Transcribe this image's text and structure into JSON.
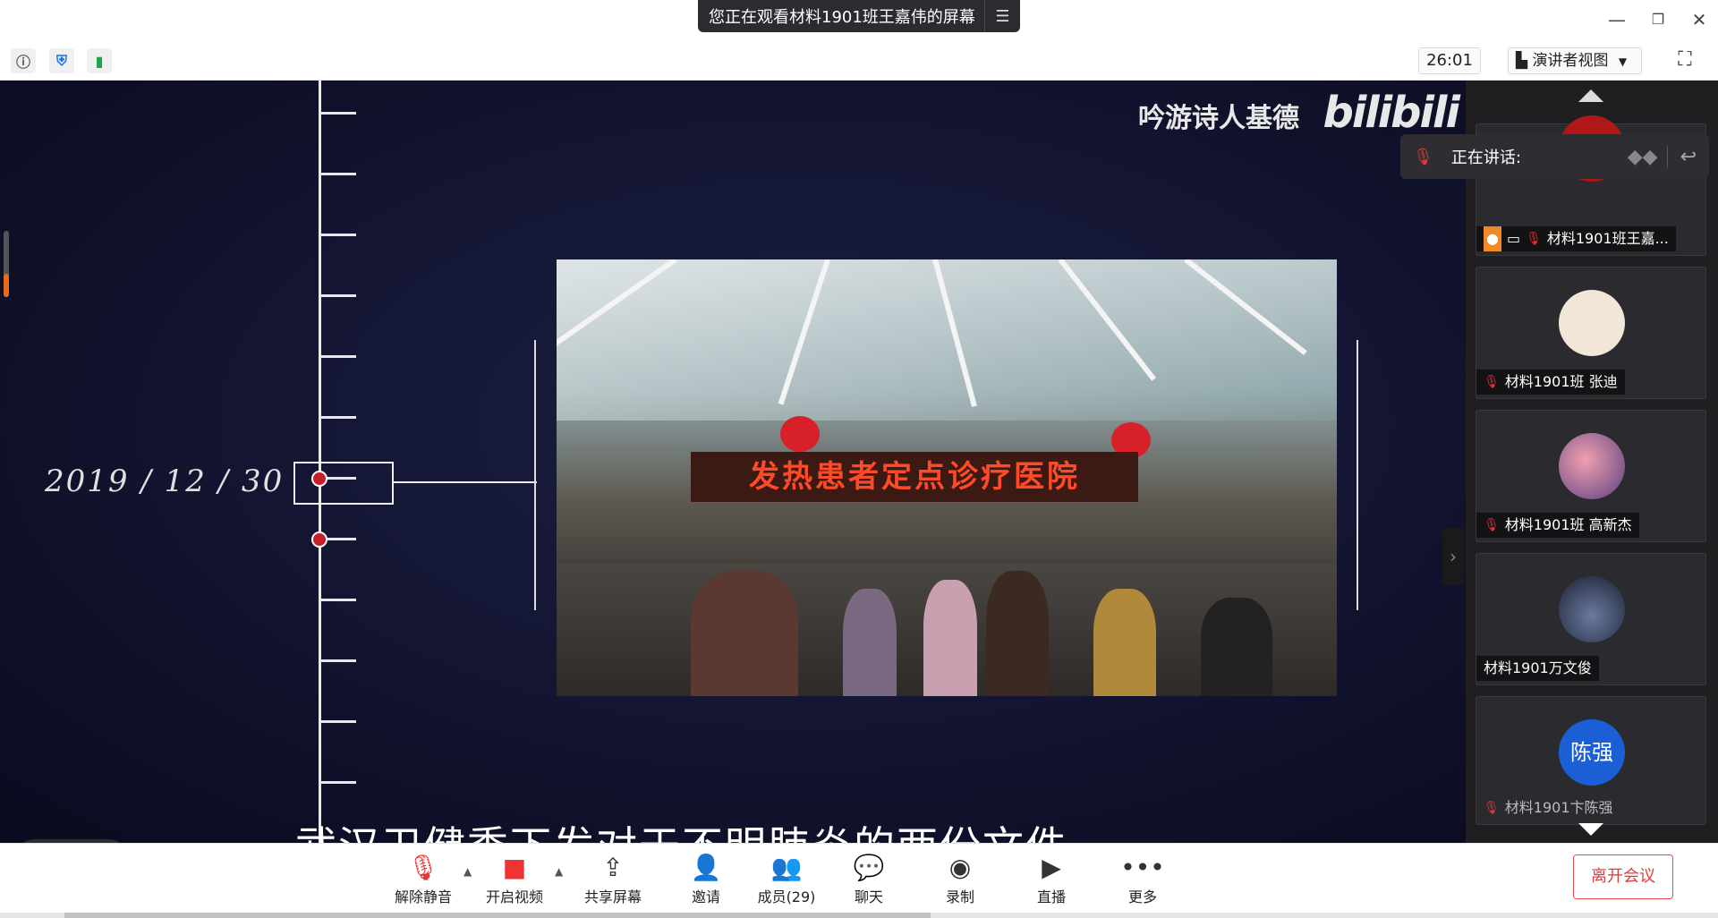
{
  "window": {
    "share_notice": "您正在观看材料1901班王嘉伟的屏幕"
  },
  "toolbar": {
    "timer": "26:01",
    "view_mode": "演讲者视图"
  },
  "slide": {
    "watermark_name": "吟游诗人基德",
    "watermark_logo": "bilibili",
    "date": "2019 / 12 / 30",
    "banner_text": "发热患者定点诊疗医院",
    "subtitle": "武汉卫健委下发对于不明肺炎的两份文件"
  },
  "speaking": {
    "label": "正在讲话:"
  },
  "participants": [
    {
      "name": "材料1901班王嘉...",
      "avatar_color": "#b01818"
    },
    {
      "name": "材料1901班 张迪",
      "avatar_color": "#f2e6d8"
    },
    {
      "name": "材料1901班 高新杰",
      "avatar_color": "#c07890"
    },
    {
      "name": "材料1901万文俊",
      "avatar_color": "#3a4560"
    },
    {
      "name": "材料1901卞陈强",
      "avatar_text": "陈强",
      "avatar_color": "#1b5fd6"
    }
  ],
  "bottom": {
    "unmute": "解除静音",
    "start_video": "开启视频",
    "share_screen": "共享屏幕",
    "invite": "邀请",
    "members": "成员(29)",
    "chat": "聊天",
    "record": "录制",
    "live": "直播",
    "more": "更多",
    "leave": "离开会议"
  },
  "colors": {
    "accent_red": "#e23a3a",
    "timeline_dot": "#c81e2a",
    "stage_bg": "#121430",
    "panel_bg": "#1f1f22"
  }
}
